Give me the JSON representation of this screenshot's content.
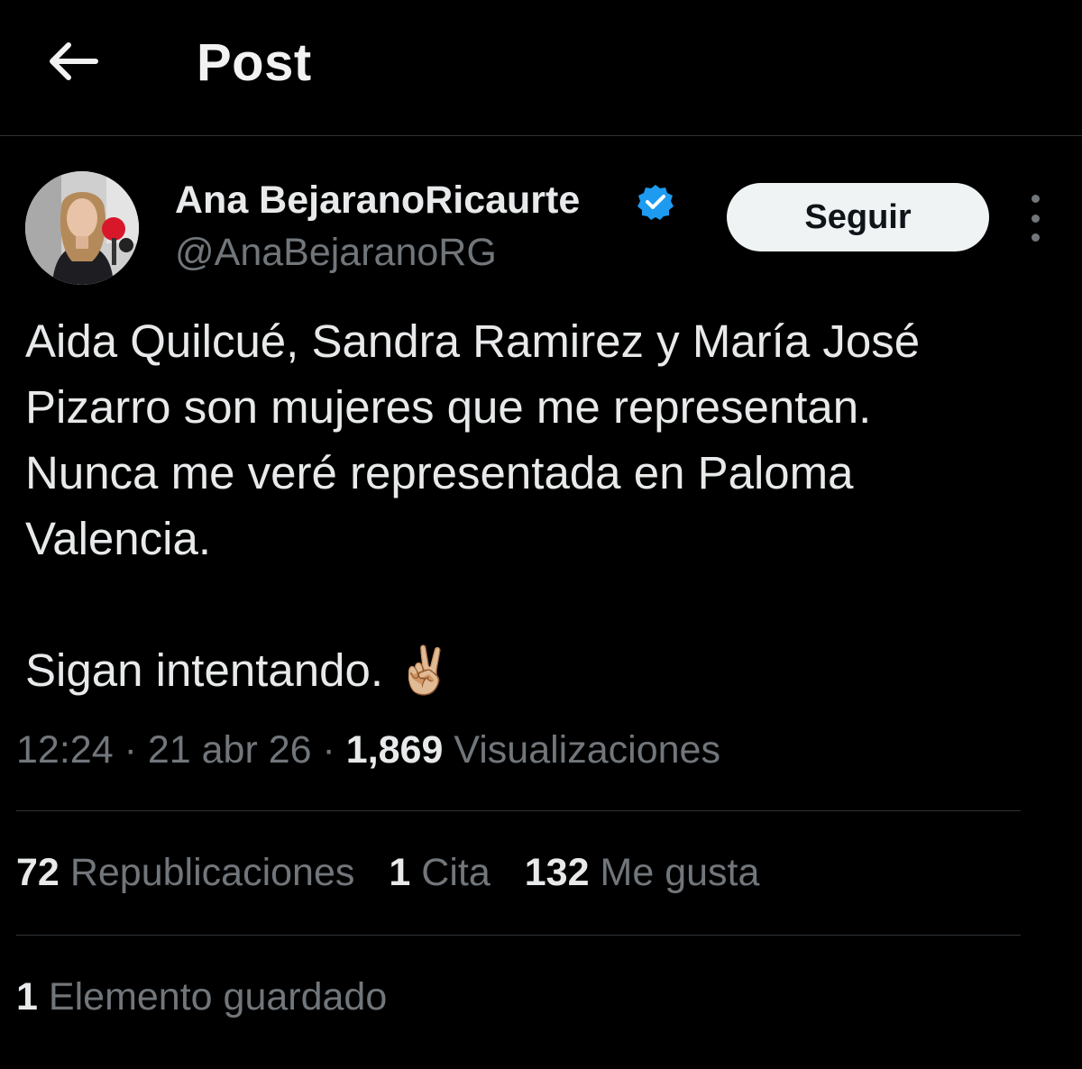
{
  "header": {
    "title": "Post",
    "back_icon": "arrow-left-icon"
  },
  "author": {
    "name": "Ana BejaranoRicaurte",
    "handle": "@AnaBejaranoRG",
    "verified_icon": "verified-badge-icon",
    "verified_color": "#1d9bf0",
    "follow_label": "Seguir",
    "more_icon": "vertical-ellipsis-icon"
  },
  "tweet": {
    "line1": "Aida Quilcué, Sandra Ramirez y María José",
    "line2": "Pizarro son mujeres que me representan.",
    "line3": "Nunca me veré representada en Paloma",
    "line4": "Valencia.",
    "line5": "Sigan intentando. ✌🏼"
  },
  "meta": {
    "time": "12:24",
    "separator": "·",
    "date": "21 abr 26",
    "views_count": "1,869",
    "views_label": "Visualizaciones"
  },
  "stats": {
    "reposts_count": "72",
    "reposts_label": "Republicaciones",
    "quotes_count": "1",
    "quotes_label": "Cita",
    "likes_count": "132",
    "likes_label": "Me gusta"
  },
  "bookmarks": {
    "count": "1",
    "label": "Elemento guardado"
  }
}
